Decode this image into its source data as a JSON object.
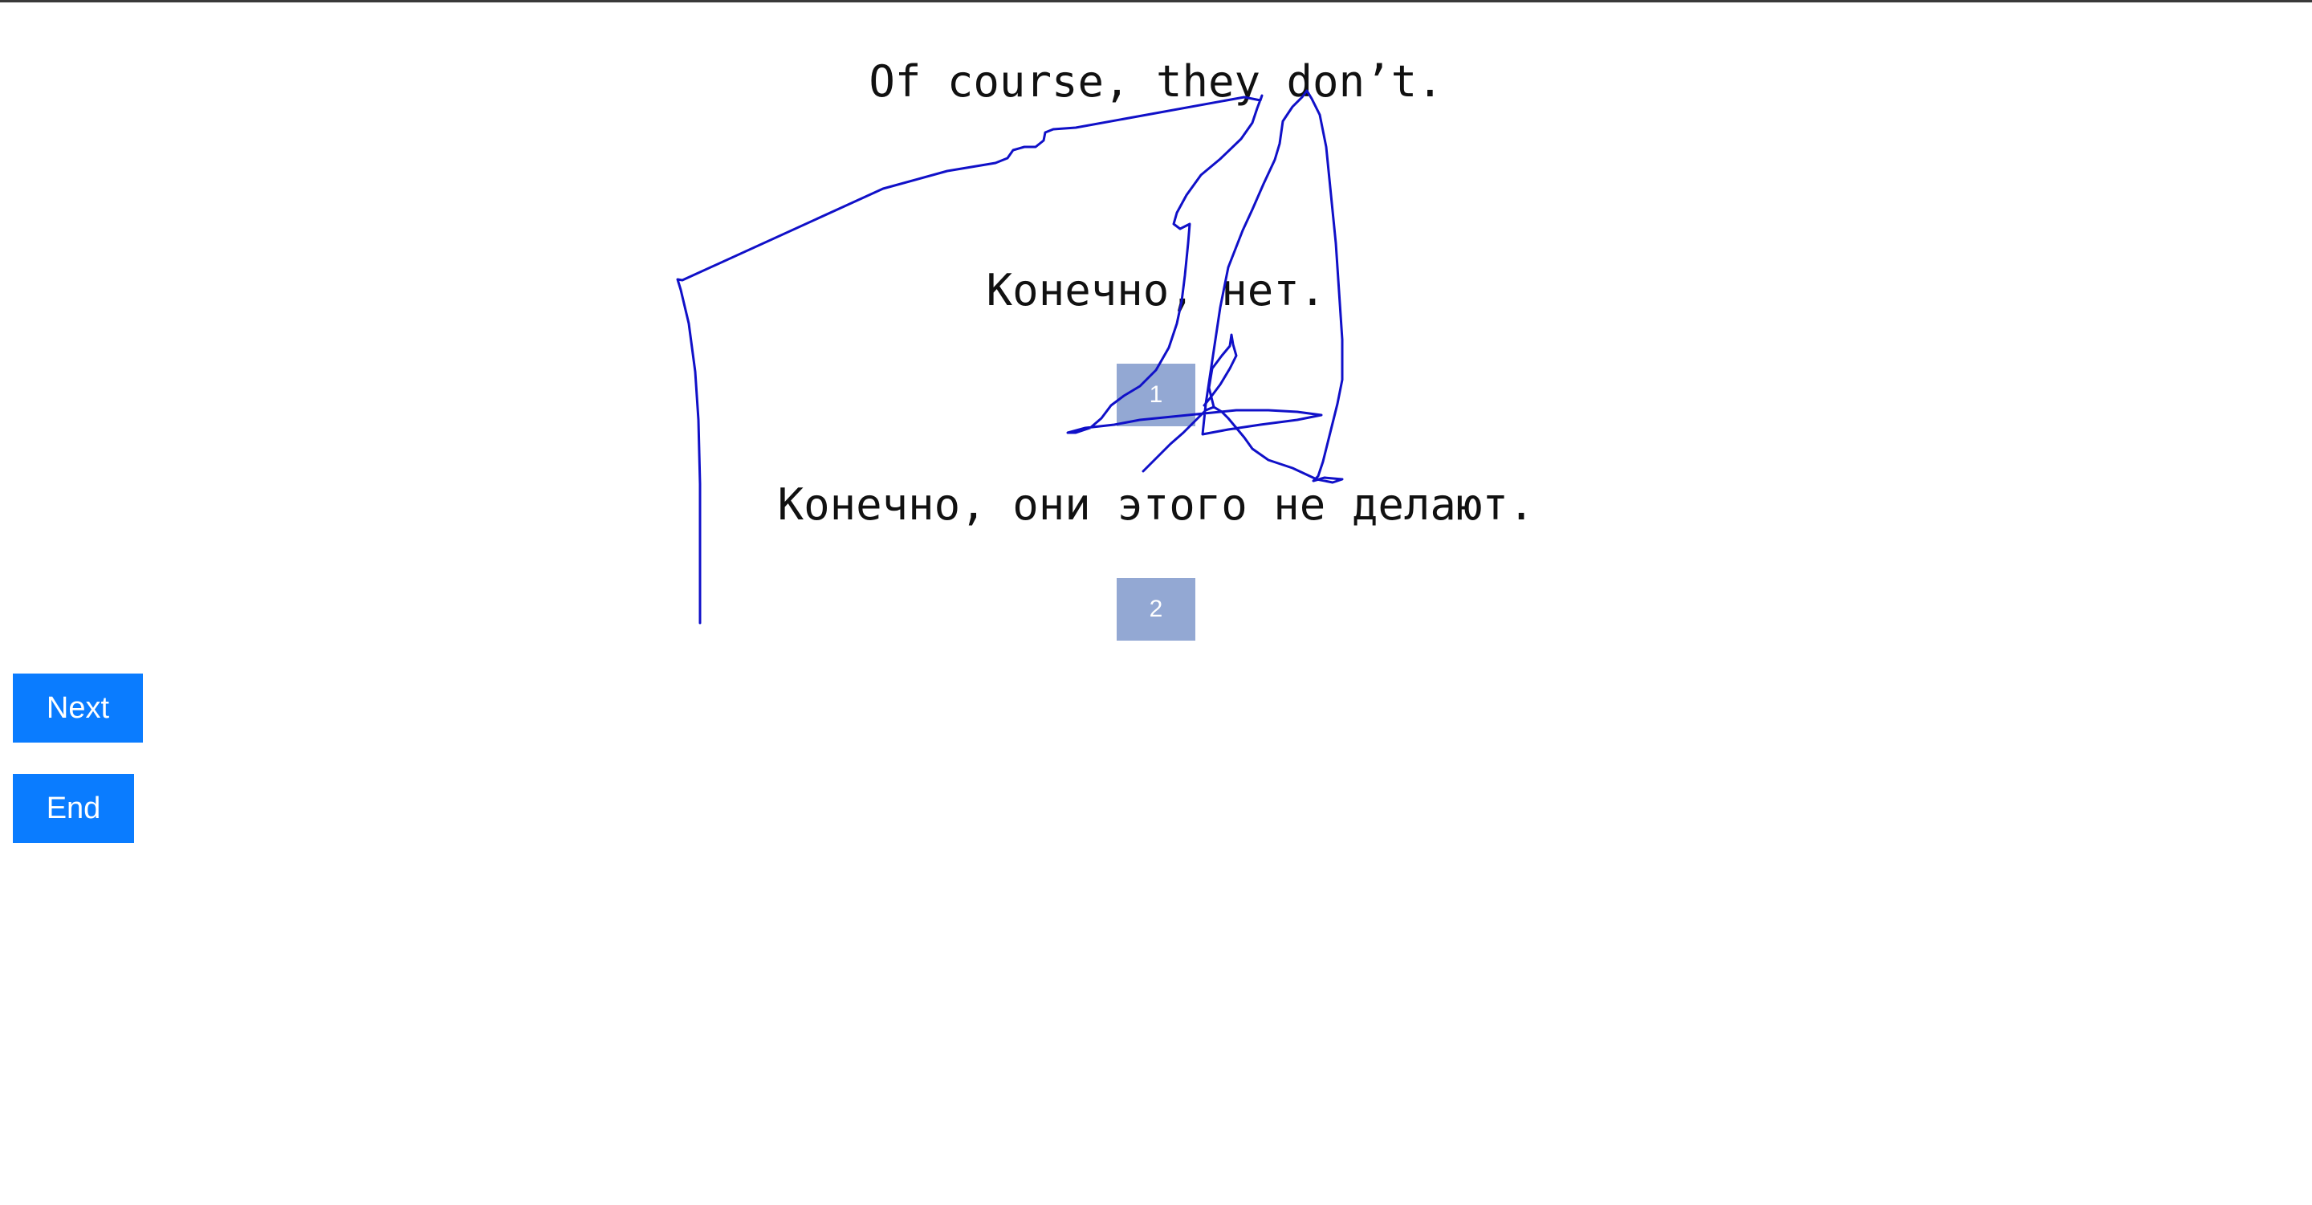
{
  "source_sentence": "Of course, they don’t.",
  "options": [
    {
      "text": "Конечно, нет.",
      "button_label": "1"
    },
    {
      "text": "Конечно, они этого не делают.",
      "button_label": "2"
    }
  ],
  "nav": {
    "next_label": "Next",
    "end_label": "End"
  },
  "colors": {
    "nav_button": "#0a7cff",
    "choice_button": "#93a8d3",
    "scribble_stroke": "#1010c8"
  }
}
